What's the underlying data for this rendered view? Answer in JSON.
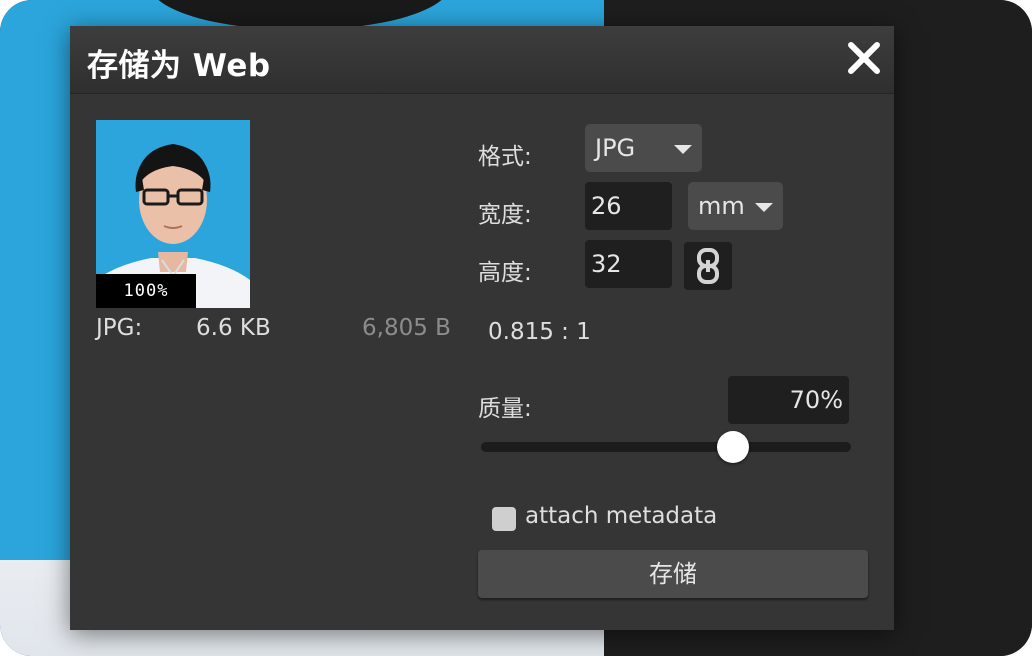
{
  "dialog": {
    "title": "存储为 Web"
  },
  "preview": {
    "zoom": "100%"
  },
  "file_info": {
    "format": "JPG:",
    "size_kb": "6.6 KB",
    "size_bytes": "6,805 B"
  },
  "settings": {
    "format_label": "格式:",
    "format_value": "JPG",
    "width_label": "宽度:",
    "width_value": "26",
    "unit_value": "mm",
    "height_label": "高度:",
    "height_value": "32",
    "ratio": "0.815 : 1",
    "quality_label": "质量:",
    "quality_value": "70%",
    "quality_fraction": 0.68,
    "metadata_label": "attach metadata",
    "metadata_checked": false,
    "save_label": "存储"
  },
  "icons": {
    "close": "close-icon",
    "link": "chain-link-icon",
    "caret": "caret-down-icon"
  },
  "colors": {
    "dialog_bg": "#353535",
    "photo_bg": "#2ba5dc",
    "control_bg": "#4b4b4b",
    "field_bg": "#1f1f1f"
  }
}
